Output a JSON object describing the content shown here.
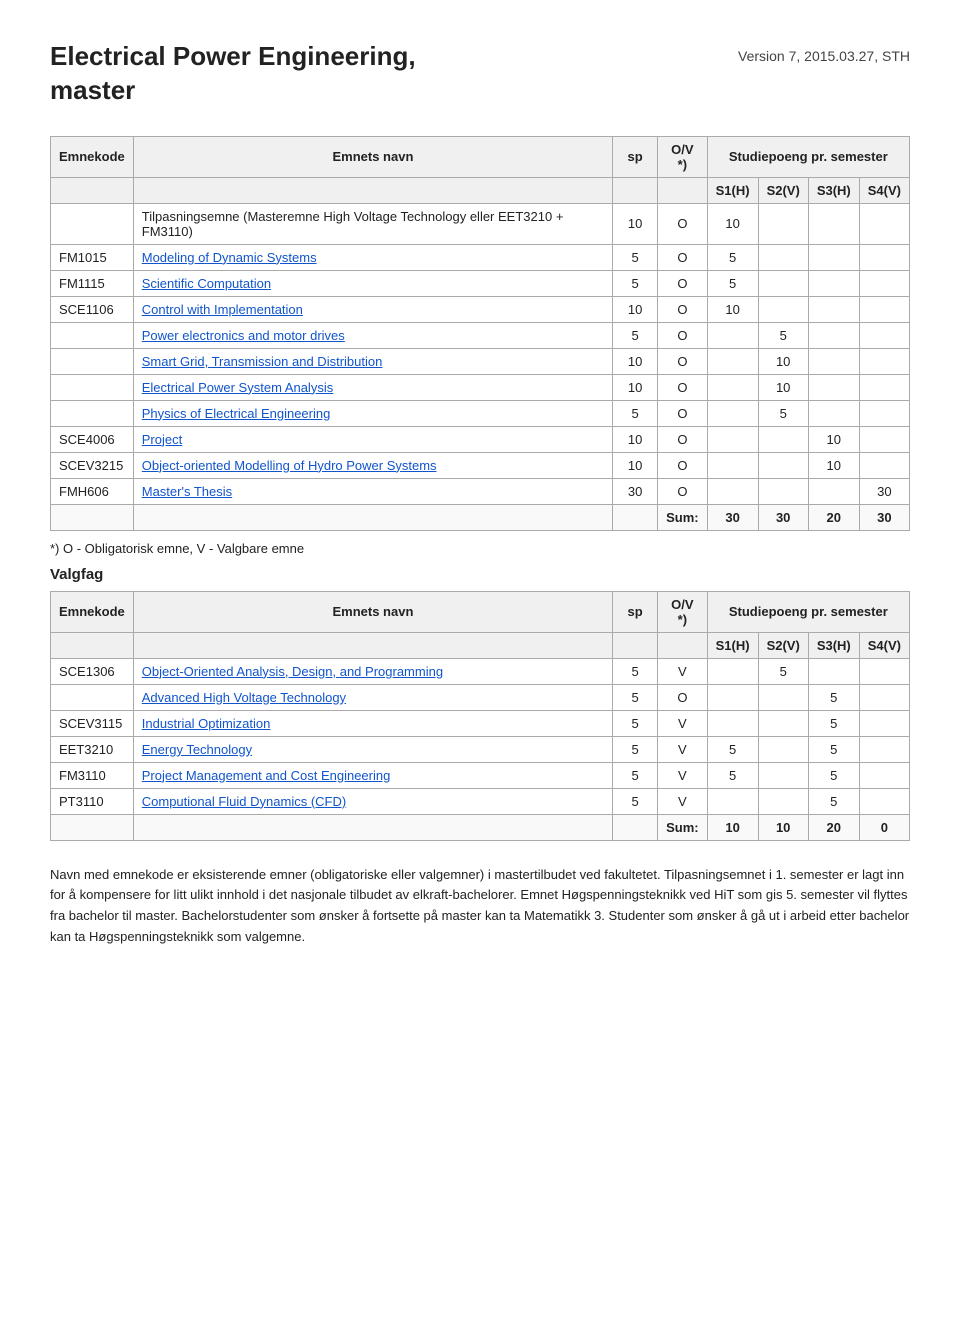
{
  "header": {
    "title_line1": "Electrical Power Engineering,",
    "title_line2": "master",
    "version": "Version 7, 2015.03.27, STH"
  },
  "main_table": {
    "col_headers": [
      "Emnekode",
      "Emnets navn",
      "sp",
      "O/V *)",
      "Studiepoeng pr. semester"
    ],
    "semester_headers": [
      "S1(H)",
      "S2(V)",
      "S3(H)",
      "S4(V)"
    ],
    "rows": [
      {
        "code": "",
        "name": "Tilpasningsemne (Masteremne High Voltage Technology eller EET3210 + FM3110)",
        "sp": "10",
        "ov": "O",
        "s1": "10",
        "s2": "",
        "s3": "",
        "s4": "",
        "link": false
      },
      {
        "code": "FM1015",
        "name": "Modeling of Dynamic Systems",
        "sp": "5",
        "ov": "O",
        "s1": "5",
        "s2": "",
        "s3": "",
        "s4": "",
        "link": true
      },
      {
        "code": "FM1115",
        "name": "Scientific Computation",
        "sp": "5",
        "ov": "O",
        "s1": "5",
        "s2": "",
        "s3": "",
        "s4": "",
        "link": true
      },
      {
        "code": "SCE1106",
        "name": "Control with Implementation",
        "sp": "10",
        "ov": "O",
        "s1": "10",
        "s2": "",
        "s3": "",
        "s4": "",
        "link": true
      },
      {
        "code": "",
        "name": "Power electronics and motor drives",
        "sp": "5",
        "ov": "O",
        "s1": "",
        "s2": "5",
        "s3": "",
        "s4": "",
        "link": true
      },
      {
        "code": "",
        "name": "Smart Grid, Transmission and Distribution",
        "sp": "10",
        "ov": "O",
        "s1": "",
        "s2": "10",
        "s3": "",
        "s4": "",
        "link": true
      },
      {
        "code": "",
        "name": "Electrical Power System Analysis",
        "sp": "10",
        "ov": "O",
        "s1": "",
        "s2": "10",
        "s3": "",
        "s4": "",
        "link": true
      },
      {
        "code": "",
        "name": "Physics of Electrical Engineering",
        "sp": "5",
        "ov": "O",
        "s1": "",
        "s2": "5",
        "s3": "",
        "s4": "",
        "link": true
      },
      {
        "code": "SCE4006",
        "name": "Project",
        "sp": "10",
        "ov": "O",
        "s1": "",
        "s2": "",
        "s3": "10",
        "s4": "",
        "link": true
      },
      {
        "code": "SCEV3215",
        "name": "Object-oriented Modelling of Hydro Power Systems",
        "sp": "10",
        "ov": "O",
        "s1": "",
        "s2": "",
        "s3": "10",
        "s4": "",
        "link": true
      },
      {
        "code": "FMH606",
        "name": "Master's Thesis",
        "sp": "30",
        "ov": "O",
        "s1": "",
        "s2": "",
        "s3": "",
        "s4": "30",
        "link": true
      }
    ],
    "sum": {
      "label": "Sum:",
      "s1": "30",
      "s2": "30",
      "s3": "20",
      "s4": "30"
    }
  },
  "note": "*) O - Obligatorisk emne, V - Valgbare emne",
  "valgfag": {
    "label": "Valgfag",
    "col_headers": [
      "Emnekode",
      "Emnets navn",
      "sp",
      "O/V *)",
      "Studiepoeng pr. semester"
    ],
    "semester_headers": [
      "S1(H)",
      "S2(V)",
      "S3(H)",
      "S4(V)"
    ],
    "rows": [
      {
        "code": "SCE1306",
        "name": "Object-Oriented Analysis, Design, and Programming",
        "sp": "5",
        "ov": "V",
        "s1": "",
        "s2": "5",
        "s3": "",
        "s4": "",
        "link": true
      },
      {
        "code": "",
        "name": "Advanced High Voltage Technology",
        "sp": "5",
        "ov": "O",
        "s1": "",
        "s2": "",
        "s3": "5",
        "s4": "",
        "link": true
      },
      {
        "code": "SCEV3115",
        "name": "Industrial Optimization",
        "sp": "5",
        "ov": "V",
        "s1": "",
        "s2": "",
        "s3": "5",
        "s4": "",
        "link": true
      },
      {
        "code": "EET3210",
        "name": "Energy Technology",
        "sp": "5",
        "ov": "V",
        "s1": "5",
        "s2": "",
        "s3": "5",
        "s4": "",
        "link": true
      },
      {
        "code": "FM3110",
        "name": "Project Management and Cost Engineering",
        "sp": "5",
        "ov": "V",
        "s1": "5",
        "s2": "",
        "s3": "5",
        "s4": "",
        "link": true
      },
      {
        "code": "PT3110",
        "name": "Computional Fluid Dynamics (CFD)",
        "sp": "5",
        "ov": "V",
        "s1": "",
        "s2": "",
        "s3": "5",
        "s4": "",
        "link": true
      }
    ],
    "sum": {
      "label": "Sum:",
      "s1": "10",
      "s2": "10",
      "s3": "20",
      "s4": "0"
    }
  },
  "footer": {
    "text": "Navn med emnekode er eksisterende emner (obligatoriske eller valgemner) i mastertilbudet ved fakultetet. Tilpasningsemnet i 1. semester er lagt inn for å kompensere for litt ulikt innhold i det nasjonale tilbudet av elkraft-bachelorer. Emnet Høgspenningsteknikk ved HiT som gis 5. semester vil flyttes fra bachelor til master. Bachelorstudenter som ønsker å fortsette på master kan ta Matematikk 3. Studenter som ønsker å gå ut i arbeid etter bachelor kan ta Høgspenningsteknikk som valgemne."
  }
}
